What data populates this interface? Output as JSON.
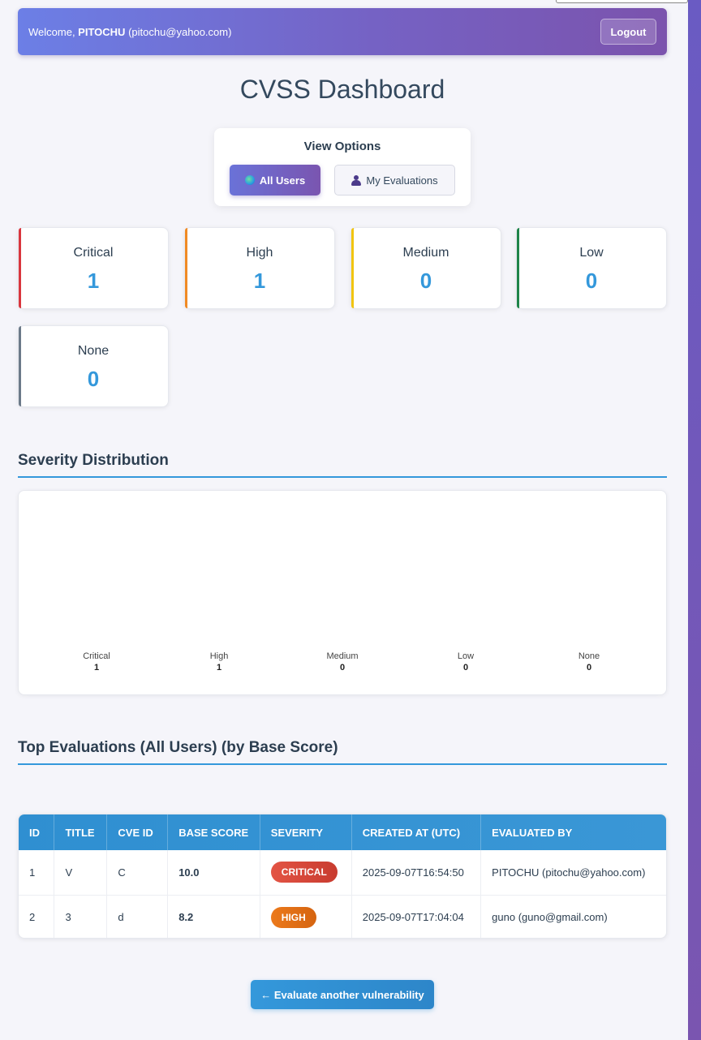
{
  "header": {
    "welcome_prefix": "Welcome, ",
    "username": "PITOCHU",
    "email": "(pitochu@yahoo.com)",
    "logout_label": "Logout"
  },
  "page_title": "CVSS Dashboard",
  "view_options": {
    "title": "View Options",
    "all_users_label": "All Users",
    "my_evaluations_label": "My Evaluations",
    "active": "All Users"
  },
  "stats": [
    {
      "label": "Critical",
      "count": "1",
      "color": "#d9363e"
    },
    {
      "label": "High",
      "count": "1",
      "color": "#f08a24"
    },
    {
      "label": "Medium",
      "count": "0",
      "color": "#f1c40f"
    },
    {
      "label": "Low",
      "count": "0",
      "color": "#1e8449"
    },
    {
      "label": "None",
      "count": "0",
      "color": "#6c7a89"
    }
  ],
  "severity_section_title": "Severity Distribution",
  "chart_data": {
    "type": "bar",
    "categories": [
      "Critical",
      "High",
      "Medium",
      "Low",
      "None"
    ],
    "values": [
      1,
      1,
      0,
      0,
      0
    ],
    "title": "",
    "xlabel": "",
    "ylabel": ""
  },
  "evaluations_section_title": "Top Evaluations (All Users) (by Base Score)",
  "table": {
    "columns": [
      "ID",
      "TITLE",
      "CVE ID",
      "BASE SCORE",
      "SEVERITY",
      "CREATED AT (UTC)",
      "EVALUATED BY"
    ],
    "rows": [
      {
        "id": "1",
        "title": "V",
        "cve_id": "C",
        "base_score": "10.0",
        "severity": "CRITICAL",
        "created_at": "2025-09-07T16:54:50",
        "evaluated_by": "PITOCHU (pitochu@yahoo.com)"
      },
      {
        "id": "2",
        "title": "3",
        "cve_id": "d",
        "base_score": "8.2",
        "severity": "HIGH",
        "created_at": "2025-09-07T17:04:04",
        "evaluated_by": "guno (guno@gmail.com)"
      }
    ]
  },
  "evaluate_button_label": "← Evaluate another vulnerability"
}
